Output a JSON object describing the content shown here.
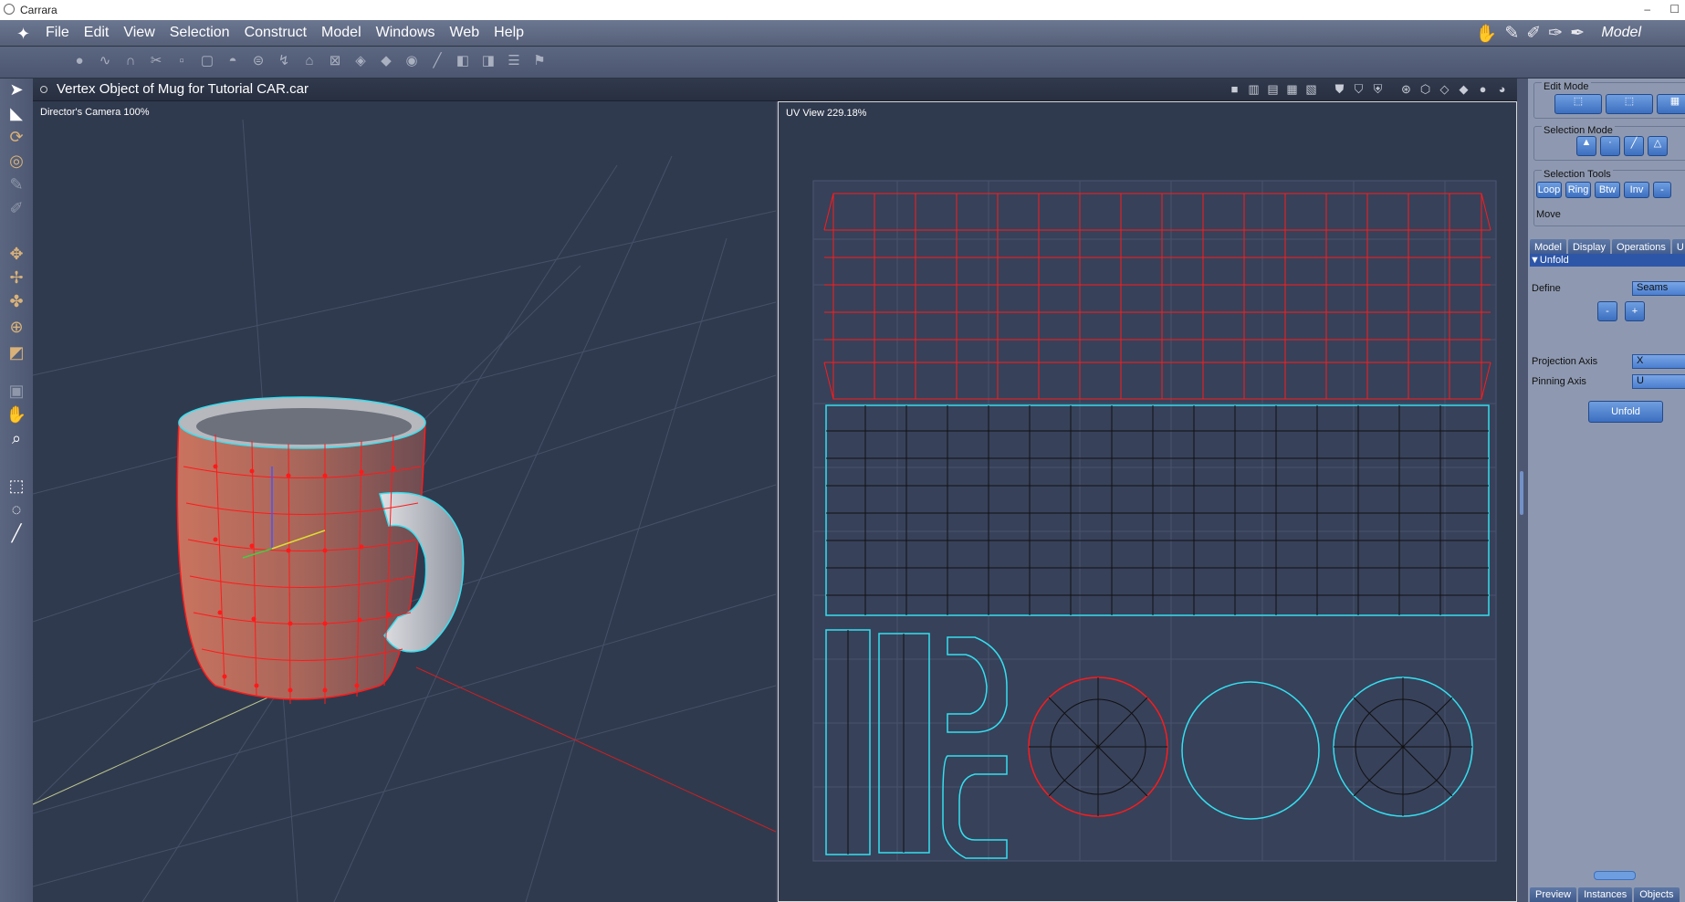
{
  "window": {
    "title": "Carrara",
    "minimize": "–",
    "close": "☐"
  },
  "menubar": {
    "logo": "✦",
    "items": [
      "File",
      "Edit",
      "View",
      "Selection",
      "Construct",
      "Model",
      "Windows",
      "Web",
      "Help"
    ],
    "room_icons": [
      "assemble-room-icon",
      "model-room-icon",
      "storyboard-room-icon",
      "texture-room-icon",
      "render-room-icon"
    ],
    "room_label": "Model"
  },
  "document": {
    "title": "Vertex Object of Mug for Tutorial CAR.car"
  },
  "viewport3d": {
    "label": "Director's Camera 100%"
  },
  "uvview": {
    "label": "UV View 229.18%"
  },
  "panel": {
    "edit_mode": {
      "title": "Edit Mode"
    },
    "selection_mode": {
      "title": "Selection Mode"
    },
    "selection_tools": {
      "title": "Selection Tools",
      "buttons": [
        "Loop",
        "Ring",
        "Btw",
        "Inv"
      ]
    },
    "current_tool": "Move",
    "tabs": [
      "Model",
      "Display",
      "Operations",
      "U"
    ],
    "section": "Unfold",
    "define_label": "Define",
    "define_value": "Seams",
    "minus": "-",
    "plus": "+",
    "projection_axis_label": "Projection Axis",
    "projection_axis_value": "X",
    "pinning_axis_label": "Pinning Axis",
    "pinning_axis_value": "U",
    "unfold_button": "Unfold",
    "bottom_tabs": [
      "Preview",
      "Instances",
      "Objects"
    ]
  },
  "colors": {
    "selection": "#ff1a1a",
    "seam": "#33e0f0",
    "accent": "#3c6fc0"
  }
}
